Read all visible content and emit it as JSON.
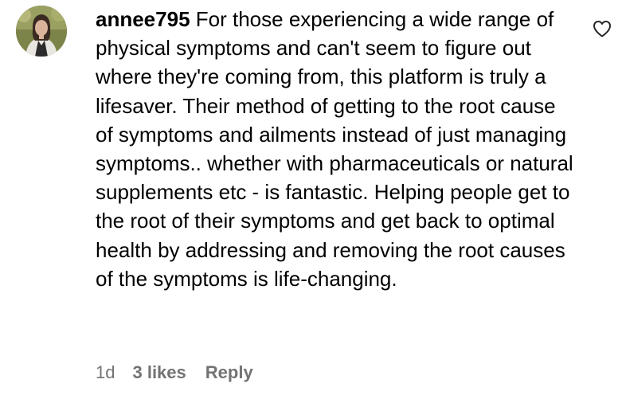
{
  "comment": {
    "username": "annee795",
    "text": "For those experiencing a wide range of physical symptoms and can't seem to figure out where they're coming from, this platform is truly a lifesaver. Their method of getting to the root cause of symptoms and ailments instead of just managing symptoms.. whether with pharmaceuticals or natural supplements etc - is fantastic. Helping people get to the root of their symptoms and get back to optimal health by addressing and removing the root causes of the symptoms is life-changing.",
    "time": "1d",
    "likes": "3 likes",
    "reply_label": "Reply",
    "like_icon": "heart-outline-icon"
  },
  "colors": {
    "text": "#000000",
    "meta": "#737373"
  }
}
